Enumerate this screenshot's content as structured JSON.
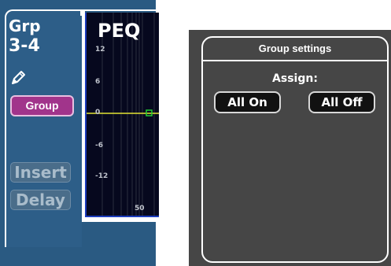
{
  "channel": {
    "label": "Grp",
    "number": "3-4",
    "group_button": "Group",
    "insert_button": "Insert",
    "delay_button": "Delay"
  },
  "peq": {
    "title": "PEQ",
    "y_ticks": [
      "12",
      "6",
      "0",
      "-6",
      "-12"
    ],
    "x_tick": "50",
    "curve_color": "#e2e233",
    "node_color": "#22cc33"
  },
  "dialog": {
    "title": "Group settings",
    "assign_label": "Assign:",
    "all_on_label": "All On",
    "all_off_label": "All Off"
  },
  "colors": {
    "group_accent": "#a1348b",
    "panel_blue": "#2a5a82",
    "dialog_bg": "#464646"
  },
  "icons": {
    "edit": "pencil-icon"
  }
}
